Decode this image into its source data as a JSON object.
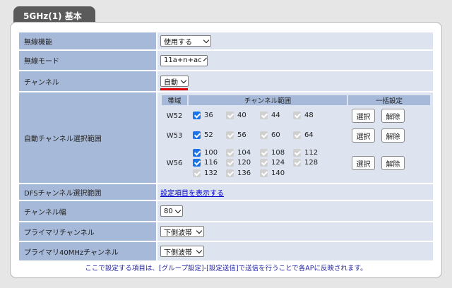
{
  "tab_title": "5GHz(1) 基本",
  "rows": {
    "wireless": {
      "label": "無線機能",
      "value": "使用する"
    },
    "mode": {
      "label": "無線モード",
      "value": "11a+n+ac"
    },
    "channel": {
      "label": "チャンネル",
      "value": "自動"
    },
    "auto_range": {
      "label": "自動チャンネル選択範囲"
    },
    "dfs": {
      "label": "DFSチャンネル選択範囲",
      "link": "設定項目を表示する"
    },
    "width": {
      "label": "チャンネル幅",
      "value": "80"
    },
    "primary": {
      "label": "プライマリチャンネル",
      "value": "下側波帯"
    },
    "primary40": {
      "label": "プライマリ40MHzチャンネル",
      "value": "下側波帯"
    }
  },
  "range_table": {
    "headers": [
      "帯域",
      "チャンネル範囲",
      "一括設定"
    ],
    "select_label": "選択",
    "clear_label": "解除",
    "bands": [
      {
        "name": "W52",
        "channels": [
          {
            "ch": "36",
            "state": "on"
          },
          {
            "ch": "40",
            "state": "dis"
          },
          {
            "ch": "44",
            "state": "dis"
          },
          {
            "ch": "48",
            "state": "dis"
          }
        ]
      },
      {
        "name": "W53",
        "channels": [
          {
            "ch": "52",
            "state": "on"
          },
          {
            "ch": "56",
            "state": "dis"
          },
          {
            "ch": "60",
            "state": "dis"
          },
          {
            "ch": "64",
            "state": "dis"
          }
        ]
      },
      {
        "name": "W56",
        "channels": [
          {
            "ch": "100",
            "state": "on"
          },
          {
            "ch": "104",
            "state": "dis"
          },
          {
            "ch": "108",
            "state": "dis"
          },
          {
            "ch": "112",
            "state": "dis"
          },
          {
            "ch": "116",
            "state": "on"
          },
          {
            "ch": "120",
            "state": "dis"
          },
          {
            "ch": "124",
            "state": "dis"
          },
          {
            "ch": "128",
            "state": "dis"
          },
          {
            "ch": "132",
            "state": "dis"
          },
          {
            "ch": "136",
            "state": "dis"
          },
          {
            "ch": "140",
            "state": "dis"
          }
        ]
      }
    ]
  },
  "footer": "ここで設定する項目は、[グループ設定]-[設定送信]で送信を行うことで各APに反映されます。",
  "colors": {
    "label_bg": "#a7b9d8",
    "value_bg": "#dee4ef",
    "highlight": "#e00000",
    "checkbox": "#1a73e8"
  }
}
